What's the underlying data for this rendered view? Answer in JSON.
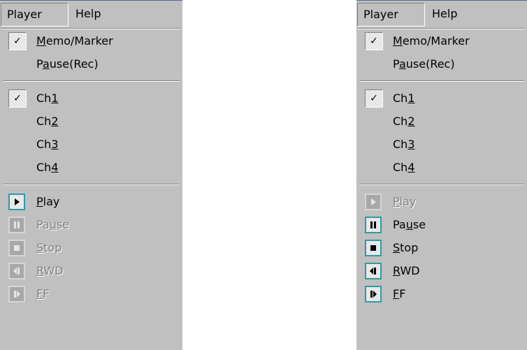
{
  "menubar": {
    "player": "Player",
    "help": "Help"
  },
  "menus": [
    {
      "top": [
        {
          "pre": "",
          "u": "M",
          "post": "emo/Marker",
          "checked": true
        },
        {
          "pre": "P",
          "u": "a",
          "post": "use(Rec)",
          "checked": false
        }
      ],
      "channels": [
        {
          "pre": "Ch",
          "u": "1",
          "post": "",
          "checked": true
        },
        {
          "pre": "Ch",
          "u": "2",
          "post": "",
          "checked": false
        },
        {
          "pre": "Ch",
          "u": "3",
          "post": "",
          "checked": false
        },
        {
          "pre": "Ch",
          "u": "4",
          "post": "",
          "checked": false
        }
      ],
      "controls": [
        {
          "pre": "",
          "u": "P",
          "post": "lay",
          "icon": "play-icon",
          "enabled": true
        },
        {
          "pre": "Pa",
          "u": "u",
          "post": "se",
          "icon": "pause-icon",
          "enabled": false
        },
        {
          "pre": "",
          "u": "S",
          "post": "top",
          "icon": "stop-icon",
          "enabled": false
        },
        {
          "pre": "",
          "u": "R",
          "post": "WD",
          "icon": "rewind-icon",
          "enabled": false
        },
        {
          "pre": "",
          "u": "F",
          "post": "F",
          "icon": "fast-forward-icon",
          "enabled": false
        }
      ]
    },
    {
      "top": [
        {
          "pre": "",
          "u": "M",
          "post": "emo/Marker",
          "checked": true
        },
        {
          "pre": "P",
          "u": "a",
          "post": "use(Rec)",
          "checked": false
        }
      ],
      "channels": [
        {
          "pre": "Ch",
          "u": "1",
          "post": "",
          "checked": true
        },
        {
          "pre": "Ch",
          "u": "2",
          "post": "",
          "checked": false
        },
        {
          "pre": "Ch",
          "u": "3",
          "post": "",
          "checked": false
        },
        {
          "pre": "Ch",
          "u": "4",
          "post": "",
          "checked": false
        }
      ],
      "controls": [
        {
          "pre": "",
          "u": "P",
          "post": "lay",
          "icon": "play-icon",
          "enabled": false
        },
        {
          "pre": "Pa",
          "u": "u",
          "post": "se",
          "icon": "pause-icon",
          "enabled": true
        },
        {
          "pre": "",
          "u": "S",
          "post": "top",
          "icon": "stop-icon",
          "enabled": true
        },
        {
          "pre": "",
          "u": "R",
          "post": "WD",
          "icon": "rewind-icon",
          "enabled": true
        },
        {
          "pre": "",
          "u": "F",
          "post": "F",
          "icon": "fast-forward-icon",
          "enabled": true
        }
      ]
    }
  ],
  "glyphs": {
    "check": "✓"
  }
}
